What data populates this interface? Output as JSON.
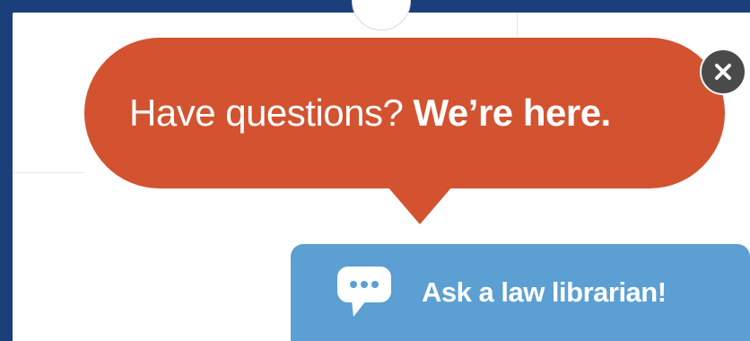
{
  "bubble": {
    "text_regular": "Have questions?",
    "text_bold": "We’re here.",
    "color": "#d35230"
  },
  "close_button": {
    "icon": "close-icon",
    "color": "#4a4a4a"
  },
  "chat_tab": {
    "label": "Ask a law librarian!",
    "icon": "chat-bubble-icon",
    "color": "#5b9fd3"
  },
  "frame_color": "#1b3f7a"
}
